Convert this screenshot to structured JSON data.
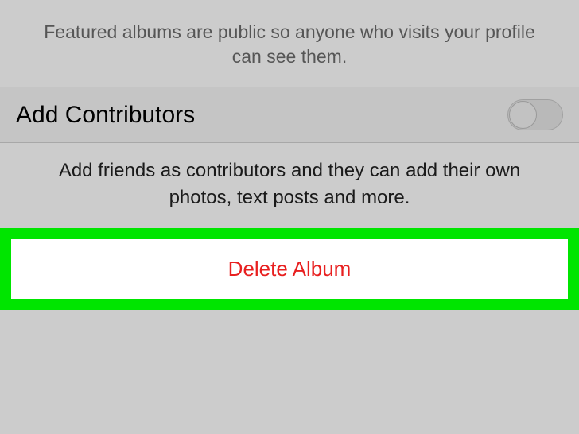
{
  "featured_albums": {
    "description": "Featured albums are public so anyone who visits your profile can see them."
  },
  "add_contributors": {
    "label": "Add Contributors",
    "description": "Add friends as contributors and they can add their own photos, text posts and more.",
    "enabled": false
  },
  "delete_album": {
    "label": "Delete Album"
  }
}
